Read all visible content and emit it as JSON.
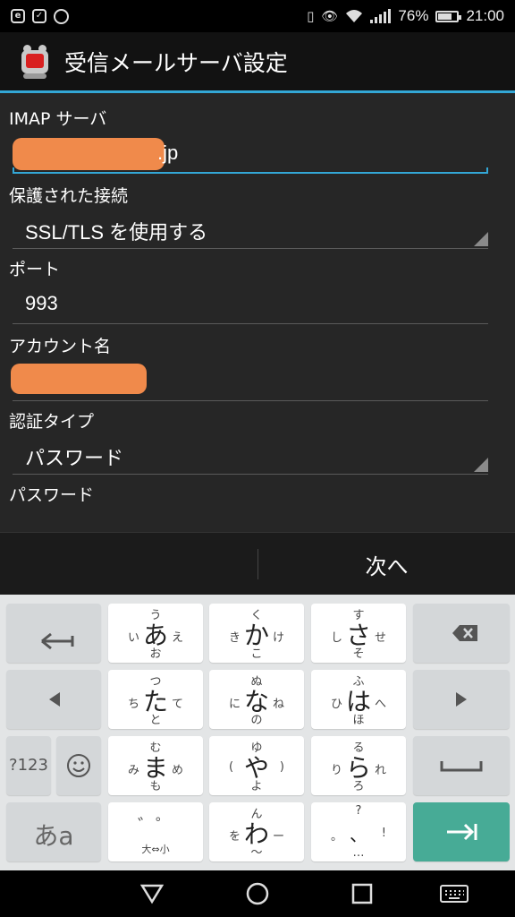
{
  "status_bar": {
    "left_icons": [
      "e-icon",
      "checkbox-icon",
      "circle-icon"
    ],
    "battery_pct": "76%",
    "battery_level": 0.76,
    "time": "21:00"
  },
  "action_bar": {
    "title": "受信メールサーバ設定",
    "accent": "#33a7d6"
  },
  "form": {
    "imap_label": "IMAP サーバ",
    "imap_value": ".jp",
    "security_label": "保護された接続",
    "security_value": "SSL/TLS を使用する",
    "port_label": "ポート",
    "port_value": "993",
    "account_label": "アカウント名",
    "account_value": "",
    "auth_label": "認証タイプ",
    "auth_value": "パスワード",
    "password_label": "パスワード"
  },
  "button_bar": {
    "next_label": "次へ"
  },
  "keyboard": {
    "rows": [
      [
        {
          "center": "あ",
          "up": "う",
          "down": "お",
          "left": "い",
          "right": "え"
        },
        {
          "center": "か",
          "up": "く",
          "down": "こ",
          "left": "き",
          "right": "け"
        },
        {
          "center": "さ",
          "up": "す",
          "down": "そ",
          "left": "し",
          "right": "せ"
        }
      ],
      [
        {
          "center": "た",
          "up": "つ",
          "down": "と",
          "left": "ち",
          "right": "て"
        },
        {
          "center": "な",
          "up": "ぬ",
          "down": "の",
          "left": "に",
          "right": "ね"
        },
        {
          "center": "は",
          "up": "ふ",
          "down": "ほ",
          "left": "ひ",
          "right": "へ"
        }
      ],
      [
        {
          "center": "ま",
          "up": "む",
          "down": "も",
          "left": "み",
          "right": "め"
        },
        {
          "center": "や",
          "up": "ゆ",
          "down": "よ",
          "left": "(",
          "right": ")"
        },
        {
          "center": "ら",
          "up": "る",
          "down": "ろ",
          "left": "り",
          "right": "れ"
        }
      ]
    ],
    "dakuten_key": {
      "top": "゛゜",
      "bottom": "大⇔小"
    },
    "wa_key": {
      "center": "わ",
      "up": "ん",
      "down": "〜",
      "left": "を",
      "right": "ー"
    },
    "punct_key": {
      "up": "?",
      "left": "。",
      "center": "、",
      "right": "!",
      "down": "…"
    },
    "num_label": "?123",
    "mode_label": "あa",
    "enter_color": "#47ab96"
  }
}
